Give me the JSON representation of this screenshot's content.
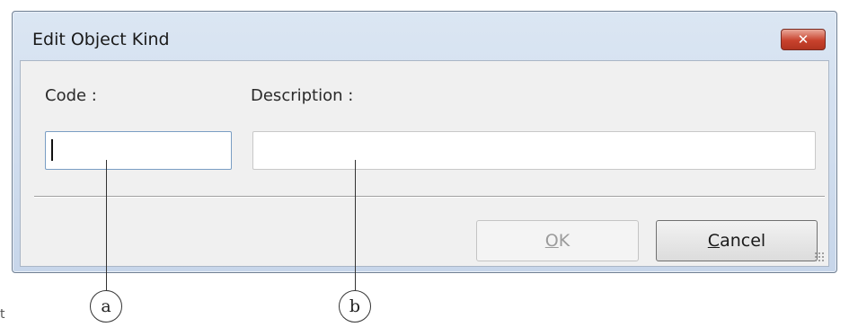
{
  "window": {
    "title": "Edit Object Kind",
    "close_glyph": "✕",
    "close_icon": "close-icon"
  },
  "form": {
    "code_label": "Code :",
    "code_value": "",
    "description_label": "Description :",
    "description_value": ""
  },
  "buttons": {
    "ok": {
      "mnemonic": "O",
      "rest": "K",
      "enabled": false
    },
    "cancel": {
      "mnemonic": "C",
      "rest": "ancel",
      "enabled": true
    }
  },
  "annotations": {
    "a": "a",
    "b": "b",
    "stray": "t"
  },
  "colors": {
    "close_red": "#c8422d",
    "frame": "#c7d6ea",
    "client_bg": "#f0f0f0"
  }
}
